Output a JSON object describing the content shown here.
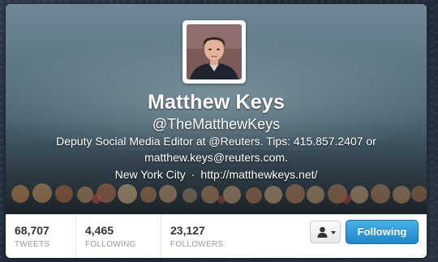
{
  "profile": {
    "name": "Matthew Keys",
    "handle": "@TheMatthewKeys",
    "bio": "Deputy Social Media Editor at @Reuters. Tips: 415.857.2407 or matthew.keys@reuters.com.",
    "location": "New York City",
    "separator": "·",
    "website": "http://matthewkeys.net/"
  },
  "stats": {
    "tweets": {
      "value": "68,707",
      "label": "TWEETS"
    },
    "following": {
      "value": "4,465",
      "label": "FOLLOWING"
    },
    "followers": {
      "value": "23,127",
      "label": "FOLLOWERS"
    }
  },
  "actions": {
    "follow_label": "Following"
  },
  "icons": {
    "user_actions": "person-icon",
    "dropdown": "caret-down-icon"
  },
  "colors": {
    "button_blue": "#2b9be0",
    "stat_label": "#999999",
    "stat_value": "#333333"
  }
}
